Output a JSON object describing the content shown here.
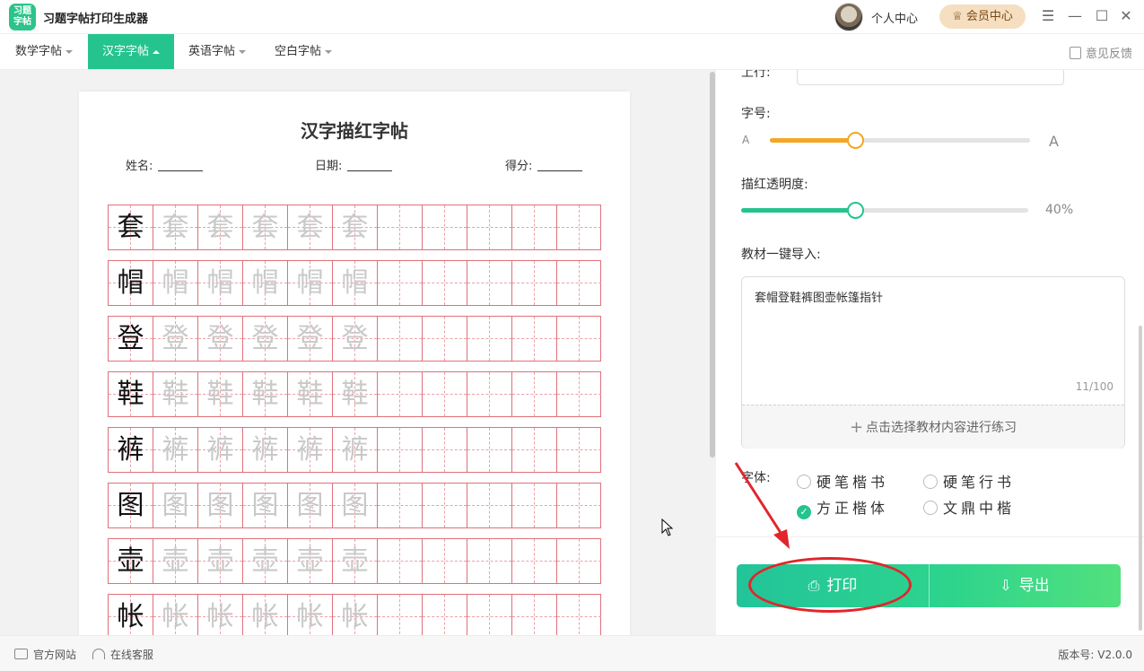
{
  "app": {
    "logo_line1": "习题",
    "logo_line2": "字帖",
    "title": "习题字帖打印生成器",
    "personal_center": "个人中心",
    "vip_center": "会员中心",
    "window_buttons": [
      "menu-icon",
      "minimize-icon",
      "maximize-icon",
      "close-icon"
    ]
  },
  "menu": {
    "tabs": [
      {
        "label": "数学字帖",
        "active": false
      },
      {
        "label": "汉字字帖",
        "active": true
      },
      {
        "label": "英语字帖",
        "active": false
      },
      {
        "label": "空白字帖",
        "active": false
      }
    ],
    "feedback": "意见反馈"
  },
  "sheet": {
    "title": "汉字描红字帖",
    "name_label": "姓名:",
    "date_label": "日期:",
    "score_label": "得分:",
    "trace_copies": 5,
    "columns": 11,
    "rows": [
      {
        "char": "套"
      },
      {
        "char": "帽"
      },
      {
        "char": "登"
      },
      {
        "char": "鞋"
      },
      {
        "char": "裤"
      },
      {
        "char": "图"
      },
      {
        "char": "壶"
      },
      {
        "char": "帐"
      }
    ]
  },
  "settings": {
    "cut_label": "上行:",
    "font_size_label": "字号:",
    "font_size_min_label": "A",
    "font_size_max_label": "A",
    "font_size_level": 0.33,
    "opacity_label": "描红透明度:",
    "opacity_value": "40%",
    "opacity_level": 0.4,
    "import_label": "教材一键导入:",
    "import_text": "套帽登鞋裤图壶帐篷指针",
    "import_count": "11/100",
    "pick_label": "点击选择教材内容进行练习",
    "font_label": "字体:",
    "fonts": [
      {
        "label": "硬笔楷书",
        "selected": false
      },
      {
        "label": "硬笔行书",
        "selected": false
      },
      {
        "label": "方正楷体",
        "selected": true
      },
      {
        "label": "文鼎中楷",
        "selected": false
      }
    ],
    "print_label": "打印",
    "export_label": "导出"
  },
  "colors": {
    "accent": "#25c48f",
    "grid_red": "#e0707a",
    "annotation_red": "#e0262b"
  },
  "status": {
    "website": "官方网站",
    "service": "在线客服",
    "version": "版本号: V2.0.0"
  }
}
